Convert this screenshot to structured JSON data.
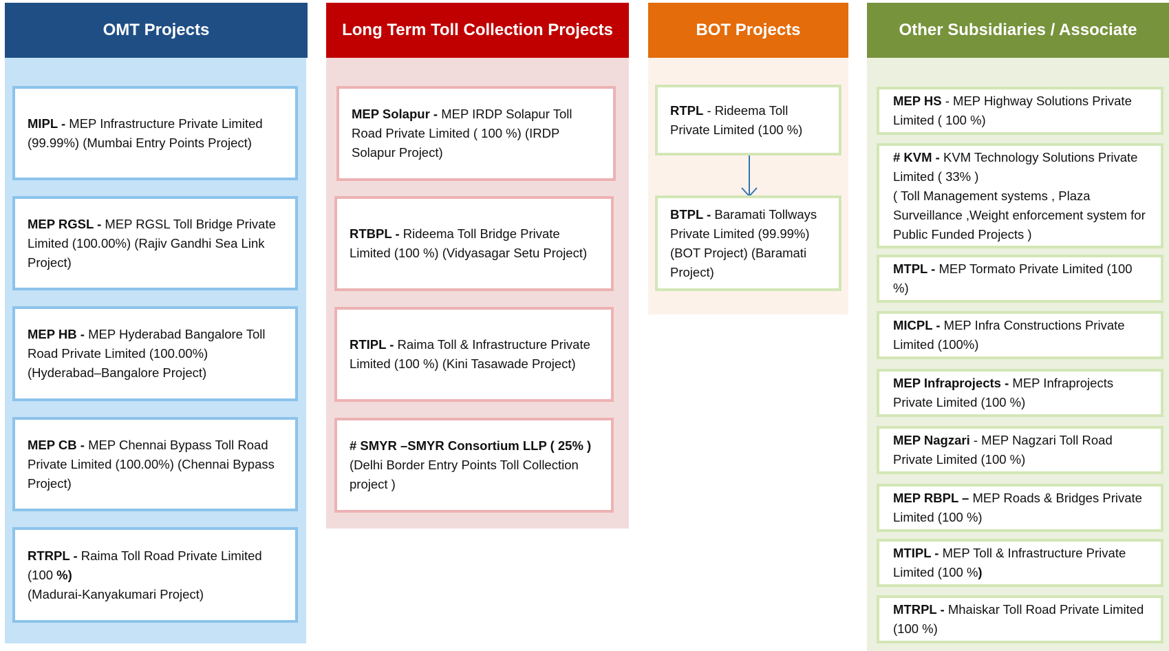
{
  "columns": [
    {
      "id": "omt",
      "header": "OMT Projects",
      "color": "#1f4e85",
      "panel_color": "#c5e2f7",
      "boxes": [
        {
          "abbr": "MIPL - ",
          "text": "MEP Infrastructure Private Limited (99.99%) (Mumbai Entry Points Project)"
        },
        {
          "abbr": "MEP RGSL - ",
          "text": "MEP RGSL Toll Bridge Private Limited (100.00%) (Rajiv Gandhi Sea Link Project)"
        },
        {
          "abbr": "MEP HB - ",
          "text": "MEP Hyderabad Bangalore Toll Road Private Limited (100.00%) (Hyderabad–Bangalore Project)"
        },
        {
          "abbr": "MEP CB - ",
          "text": "MEP Chennai Bypass Toll Road Private Limited (100.00%) (Chennai Bypass Project)"
        },
        {
          "abbr": "RTRPL - ",
          "text": "Raima Toll Road Private Limited (100 ",
          "bold_tail": "%)",
          "line2": "(Madurai-Kanyakumari Project)"
        }
      ]
    },
    {
      "id": "ltc",
      "header": "Long Term Toll Collection Projects",
      "color": "#c00000",
      "panel_color": "#f2dcdb",
      "boxes": [
        {
          "abbr": "MEP Solapur - ",
          "text": "MEP IRDP Solapur Toll Road Private Limited ( 100 %) (IRDP Solapur Project)"
        },
        {
          "abbr": "RTBPL - ",
          "text": "Rideema Toll Bridge Private Limited (100 %) (Vidyasagar Setu Project)"
        },
        {
          "abbr": "RTIPL - ",
          "text": "Raima Toll & Infrastructure Private Limited (100 %) (Kini Tasawade Project)"
        },
        {
          "abbr": "# SMYR –SMYR Consortium  LLP ( 25% )",
          "text": "",
          "line2": "(Delhi Border Entry Points Toll Collection project )"
        }
      ]
    },
    {
      "id": "bot",
      "header": "BOT Projects",
      "color": "#e46c0a",
      "panel_color": "#fdf2ea",
      "boxes": [
        {
          "abbr": "RTPL",
          "text": " - Rideema Toll Private Limited (100 %)"
        },
        {
          "abbr": "BTPL - ",
          "text": "Baramati Tollways Private Limited (99.99%) (BOT Project) (Baramati Project)"
        }
      ]
    },
    {
      "id": "oth",
      "header": "Other Subsidiaries / Associate",
      "color": "#77933c",
      "panel_color": "#ebf1de",
      "boxes": [
        {
          "abbr": "MEP HS",
          "text": " - MEP Highway Solutions Private Limited ( 100 %)"
        },
        {
          "abbr": "# KVM - ",
          "text": "KVM Technology  Solutions Private Limited  ( 33% )",
          "line2": "( Toll Management systems  , Plaza Surveillance  ,Weight  enforcement system for Public Funded Projects )"
        },
        {
          "abbr": "MTPL - ",
          "text": "MEP Tormato Private Limited (100 %)"
        },
        {
          "abbr": "MICPL - ",
          "text": "MEP Infra Constructions Private Limited (100%)"
        },
        {
          "abbr": "MEP Infraprojects - ",
          "text": "MEP Infraprojects Private Limited (100 %)"
        },
        {
          "abbr": "MEP Nagzari",
          "text": " - MEP Nagzari Toll Road Private Limited (100 %)"
        },
        {
          "abbr": "MEP RBPL – ",
          "text": "MEP Roads & Bridges Private Limited  (100 %)"
        },
        {
          "abbr": "MTIPL - ",
          "text": "MEP Toll & Infrastructure Private Limited (100 %",
          "bold_tail": ")"
        },
        {
          "abbr": "MTRPL - ",
          "text": "Mhaiskar Toll Road Private Limited (100 %)"
        }
      ]
    }
  ]
}
